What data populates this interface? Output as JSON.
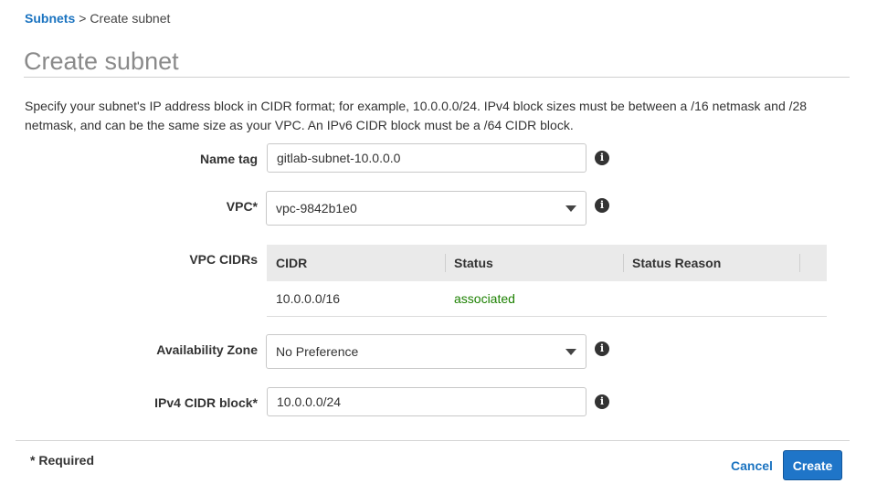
{
  "breadcrumb": {
    "parent": "Subnets",
    "separator": ">",
    "current": "Create subnet"
  },
  "page_title": "Create subnet",
  "description": "Specify your subnet's IP address block in CIDR format; for example, 10.0.0.0/24. IPv4 block sizes must be between a /16 netmask and /28 netmask, and can be the same size as your VPC. An IPv6 CIDR block must be a /64 CIDR block.",
  "form": {
    "name_tag": {
      "label": "Name tag",
      "value": "gitlab-subnet-10.0.0.0"
    },
    "vpc": {
      "label": "VPC*",
      "value": "vpc-9842b1e0"
    },
    "vpc_cidrs": {
      "label": "VPC CIDRs",
      "columns": [
        "CIDR",
        "Status",
        "Status Reason"
      ],
      "rows": [
        {
          "cidr": "10.0.0.0/16",
          "status": "associated",
          "reason": ""
        }
      ]
    },
    "availability_zone": {
      "label": "Availability Zone",
      "value": "No Preference"
    },
    "ipv4_cidr": {
      "label": "IPv4 CIDR block*",
      "value": "10.0.0.0/24"
    }
  },
  "info_icon_glyph": "i",
  "footer": {
    "required_note": "* Required",
    "cancel_label": "Cancel",
    "create_label": "Create"
  },
  "colors": {
    "link": "#1a73c0",
    "primary_button": "#1f75c8",
    "status_associated": "#1d8102"
  }
}
